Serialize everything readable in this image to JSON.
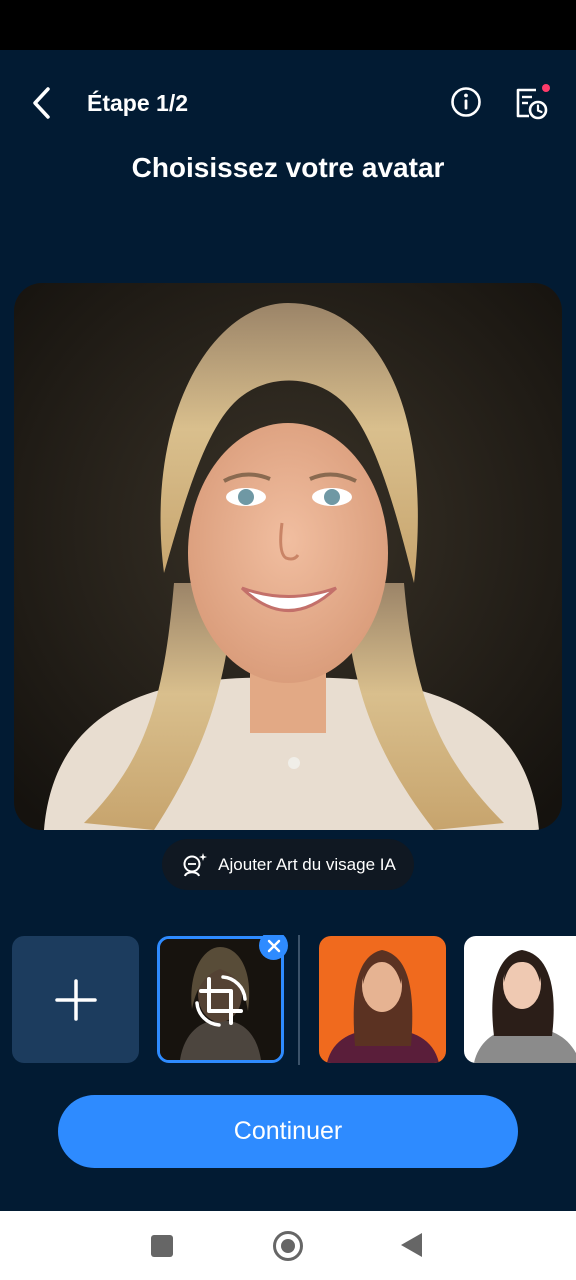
{
  "header": {
    "back_icon": "chevron-left-icon",
    "step": "Étape 1/2",
    "info_icon": "info-icon",
    "history_icon": "history-clock-icon",
    "notification_color": "#FF3B6A"
  },
  "title": "Choisissez votre avatar",
  "ai_face": {
    "label": "Ajouter Art du visage IA",
    "icon": "ai-face-icon"
  },
  "thumbnails": {
    "add_icon": "plus-icon",
    "selected_icon": "crop-rotate-icon",
    "remove_icon": "close-icon"
  },
  "continue_label": "Continuer",
  "colors": {
    "background": "#021B33",
    "accent": "#2E8BFF",
    "tile": "#1C3C5E"
  }
}
